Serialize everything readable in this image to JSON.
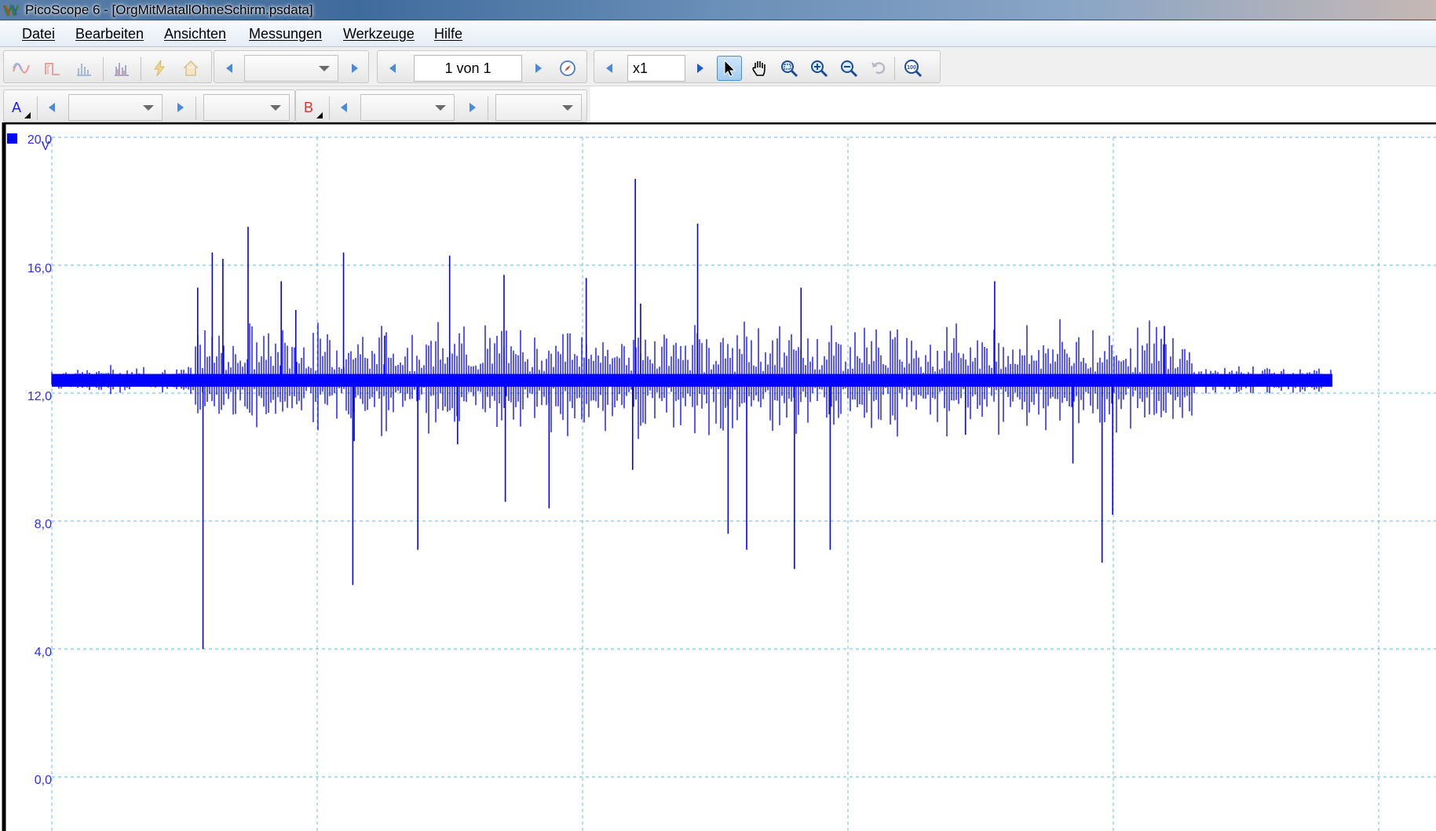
{
  "window": {
    "title": "PicoScope 6 - [OrgMitMatallOhneSchirm.psdata]"
  },
  "menu": [
    {
      "label": "Datei"
    },
    {
      "label": "Bearbeiten"
    },
    {
      "label": "Ansichten"
    },
    {
      "label": "Messungen"
    },
    {
      "label": "Werkzeuge"
    },
    {
      "label": "Hilfe"
    }
  ],
  "toolbar": {
    "mode_buttons": [
      {
        "icon": "scope-mode-icon"
      },
      {
        "icon": "persistence-mode-icon"
      },
      {
        "icon": "spectrum-mode-icon"
      },
      {
        "icon": "spectrum-persistence-icon"
      },
      {
        "icon": "automotive-icon"
      },
      {
        "icon": "home-icon"
      }
    ],
    "timebase": {
      "value": ""
    },
    "buffer": {
      "value": "1 von 1"
    },
    "zoom_factor": {
      "value": "x1"
    },
    "tools": [
      {
        "icon": "pointer-icon",
        "active": true
      },
      {
        "icon": "hand-pan-icon",
        "active": false
      },
      {
        "icon": "zoom-area-icon",
        "active": false
      },
      {
        "icon": "zoom-in-icon",
        "active": false
      },
      {
        "icon": "zoom-out-icon",
        "active": false
      },
      {
        "icon": "undo-zoom-icon",
        "active": false
      },
      {
        "icon": "zoom-100-icon",
        "active": false
      }
    ]
  },
  "channels": [
    {
      "label": "A",
      "color": "#1a1aff",
      "range": "",
      "coupling": ""
    },
    {
      "label": "B",
      "color": "#e03030",
      "range": "",
      "coupling": ""
    }
  ],
  "chart_data": {
    "type": "line",
    "series": [
      {
        "name": "A",
        "color": "#0000ff",
        "baseline_band": [
          12.2,
          12.6
        ],
        "spikes": [
          {
            "x": 0.11,
            "y": 15.3
          },
          {
            "x": 0.114,
            "y": 4.0
          },
          {
            "x": 0.121,
            "y": 16.4
          },
          {
            "x": 0.129,
            "y": 16.2
          },
          {
            "x": 0.148,
            "y": 17.2
          },
          {
            "x": 0.173,
            "y": 15.5
          },
          {
            "x": 0.184,
            "y": 14.6
          },
          {
            "x": 0.22,
            "y": 16.4
          },
          {
            "x": 0.227,
            "y": 6.0
          },
          {
            "x": 0.228,
            "y": 10.5
          },
          {
            "x": 0.251,
            "y": 13.8
          },
          {
            "x": 0.276,
            "y": 7.1
          },
          {
            "x": 0.3,
            "y": 16.3
          },
          {
            "x": 0.306,
            "y": 10.4
          },
          {
            "x": 0.341,
            "y": 15.7
          },
          {
            "x": 0.342,
            "y": 8.6
          },
          {
            "x": 0.375,
            "y": 8.4
          },
          {
            "x": 0.403,
            "y": 15.6
          },
          {
            "x": 0.438,
            "y": 9.6
          },
          {
            "x": 0.44,
            "y": 18.7
          },
          {
            "x": 0.444,
            "y": 14.8
          },
          {
            "x": 0.487,
            "y": 17.3
          },
          {
            "x": 0.51,
            "y": 7.6
          },
          {
            "x": 0.524,
            "y": 7.1
          },
          {
            "x": 0.56,
            "y": 6.5
          },
          {
            "x": 0.565,
            "y": 15.3
          },
          {
            "x": 0.587,
            "y": 7.1
          },
          {
            "x": 0.689,
            "y": 10.7
          },
          {
            "x": 0.711,
            "y": 15.5
          },
          {
            "x": 0.77,
            "y": 9.8
          },
          {
            "x": 0.792,
            "y": 6.7
          },
          {
            "x": 0.8,
            "y": 8.2
          },
          {
            "x": 0.839,
            "y": 14.1
          }
        ]
      }
    ],
    "y_ticks": [
      "20,0",
      "16,0",
      "12,0",
      "8,0",
      "4,0",
      "0,0"
    ],
    "y_unit": "V",
    "ylim": [
      -1.6,
      20.0
    ],
    "grid": true
  }
}
